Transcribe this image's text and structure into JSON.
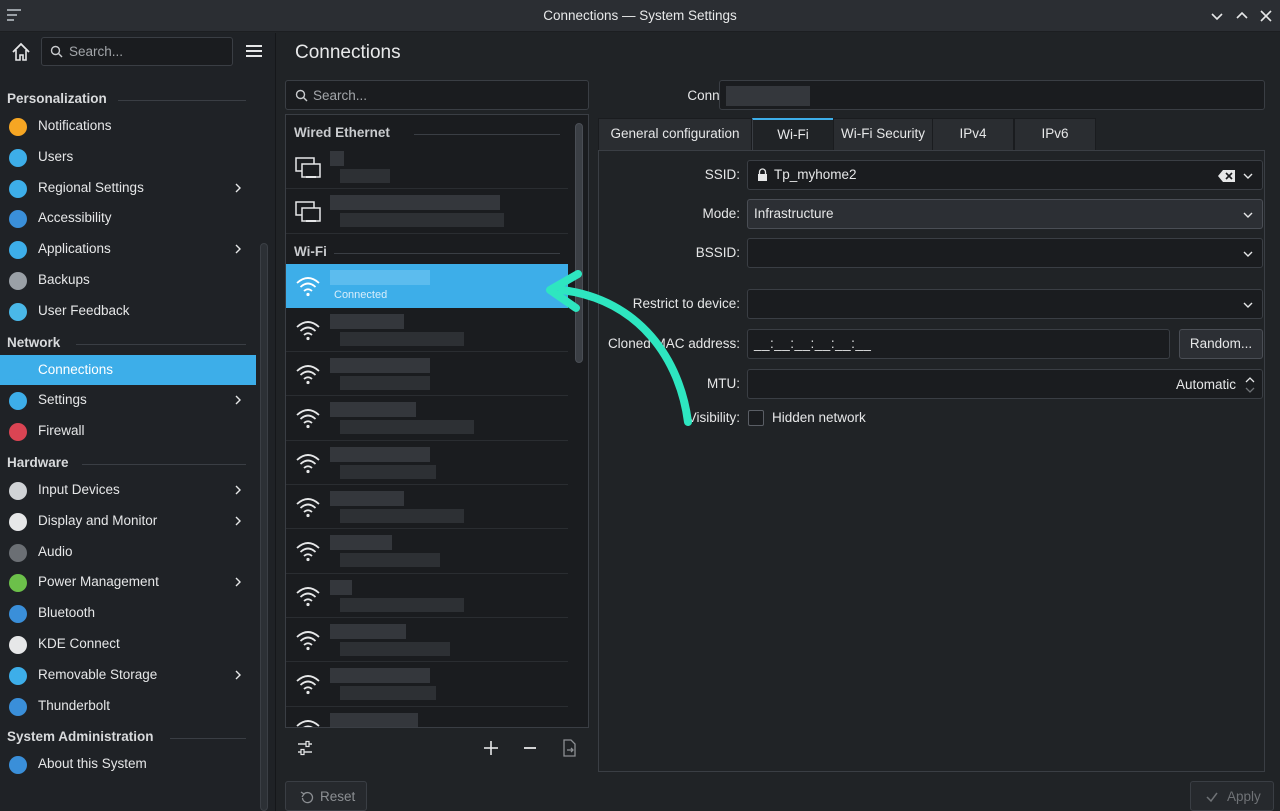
{
  "window": {
    "title": "Connections — System Settings"
  },
  "sidebar": {
    "search_placeholder": "Search...",
    "sections": [
      {
        "title": "Personalization",
        "items": [
          {
            "label": "Notifications",
            "icon": "bell-icon",
            "color": "#f6a623",
            "chevron": false
          },
          {
            "label": "Users",
            "icon": "users-icon",
            "color": "#3daee9",
            "chevron": false
          },
          {
            "label": "Regional Settings",
            "icon": "regional-settings-icon",
            "color": "#3daee9",
            "chevron": true
          },
          {
            "label": "Accessibility",
            "icon": "accessibility-icon",
            "color": "#3a8fd9",
            "chevron": false
          },
          {
            "label": "Applications",
            "icon": "applications-icon",
            "color": "#3daee9",
            "chevron": true
          },
          {
            "label": "Backups",
            "icon": "backups-icon",
            "color": "#9aa0a6",
            "chevron": false
          },
          {
            "label": "User Feedback",
            "icon": "feedback-icon",
            "color": "#4ab8e8",
            "chevron": false
          }
        ]
      },
      {
        "title": "Network",
        "items": [
          {
            "label": "Connections",
            "icon": "connections-globe-icon",
            "color": "#3daee9",
            "chevron": false,
            "active": true
          },
          {
            "label": "Settings",
            "icon": "network-settings-globe-icon",
            "color": "#3daee9",
            "chevron": true
          },
          {
            "label": "Firewall",
            "icon": "firewall-icon",
            "color": "#da4453",
            "chevron": false
          }
        ]
      },
      {
        "title": "Hardware",
        "items": [
          {
            "label": "Input Devices",
            "icon": "mouse-icon",
            "color": "#d0d3d6",
            "chevron": true
          },
          {
            "label": "Display and Monitor",
            "icon": "monitor-icon",
            "color": "#e6e7e8",
            "chevron": true
          },
          {
            "label": "Audio",
            "icon": "speaker-icon",
            "color": "#6b6f74",
            "chevron": false
          },
          {
            "label": "Power Management",
            "icon": "power-icon",
            "color": "#6cc04a",
            "chevron": true
          },
          {
            "label": "Bluetooth",
            "icon": "bluetooth-icon",
            "color": "#3a8fd9",
            "chevron": false
          },
          {
            "label": "KDE Connect",
            "icon": "kde-connect-phone-icon",
            "color": "#e6e7e8",
            "chevron": false
          },
          {
            "label": "Removable Storage",
            "icon": "usb-storage-icon",
            "color": "#3daee9",
            "chevron": true
          },
          {
            "label": "Thunderbolt",
            "icon": "thunderbolt-icon",
            "color": "#3a8fd9",
            "chevron": false
          }
        ]
      },
      {
        "title": "System Administration",
        "items": [
          {
            "label": "About this System",
            "icon": "info-icon",
            "color": "#3a8fd9",
            "chevron": false
          }
        ]
      }
    ]
  },
  "page": {
    "title": "Connections"
  },
  "connections": {
    "search_placeholder": "Search...",
    "wired_section": "Wired Ethernet",
    "wifi_section": "Wi-Fi",
    "active_status": "Connected"
  },
  "detail": {
    "connection_name_label": "Connection name:",
    "tabs": [
      "General configuration",
      "Wi-Fi",
      "Wi-Fi Security",
      "IPv4",
      "IPv6"
    ],
    "active_tab": "Wi-Fi",
    "fields": {
      "ssid_label": "SSID:",
      "ssid_value": "Tp_myhome2",
      "mode_label": "Mode:",
      "mode_value": "Infrastructure",
      "bssid_label": "BSSID:",
      "bssid_value": "",
      "restrict_label": "Restrict to device:",
      "restrict_value": "",
      "cloned_mac_label": "Cloned MAC address:",
      "cloned_mac_value": "__:__:__:__:__:__",
      "random_button": "Random...",
      "mtu_label": "MTU:",
      "mtu_value": "Automatic",
      "visibility_label": "Visibility:",
      "hidden_network_label": "Hidden network"
    }
  },
  "footer": {
    "reset_label": "Reset",
    "apply_label": "Apply"
  },
  "colors": {
    "accent": "#3daee9",
    "annotation_arrow": "#2ee6c0"
  }
}
